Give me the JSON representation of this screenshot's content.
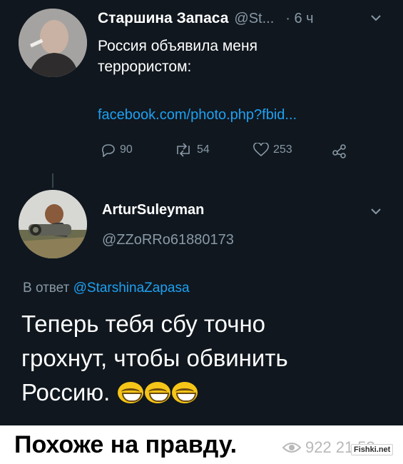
{
  "tweet": {
    "author_name": "Старшина Запаса",
    "author_handle": "@St...",
    "time": "· 6 ч",
    "text_line1": "Россия объявила меня",
    "text_line2": "террористом:",
    "link": "facebook.com/photo.php?fbid...",
    "replies": "90",
    "retweets": "54",
    "likes": "253"
  },
  "reply": {
    "author_name": "ArturSuleyman",
    "author_handle": "@ZZoRRo61880173",
    "reply_prefix": "В ответ",
    "reply_to": "@StarshinaZapasa",
    "text_line1": "Теперь тебя сбу точно",
    "text_line2": "грохнут, чтобы обвинить",
    "text_line3": "Россию.",
    "emoji_count": 3
  },
  "post": {
    "caption": "Похоже на правду.",
    "views": "922",
    "time_partial": "21:53",
    "watermark": "Fishki.net"
  },
  "colors": {
    "background": "#10171e",
    "link": "#1da1f2",
    "muted": "#8899a6"
  }
}
